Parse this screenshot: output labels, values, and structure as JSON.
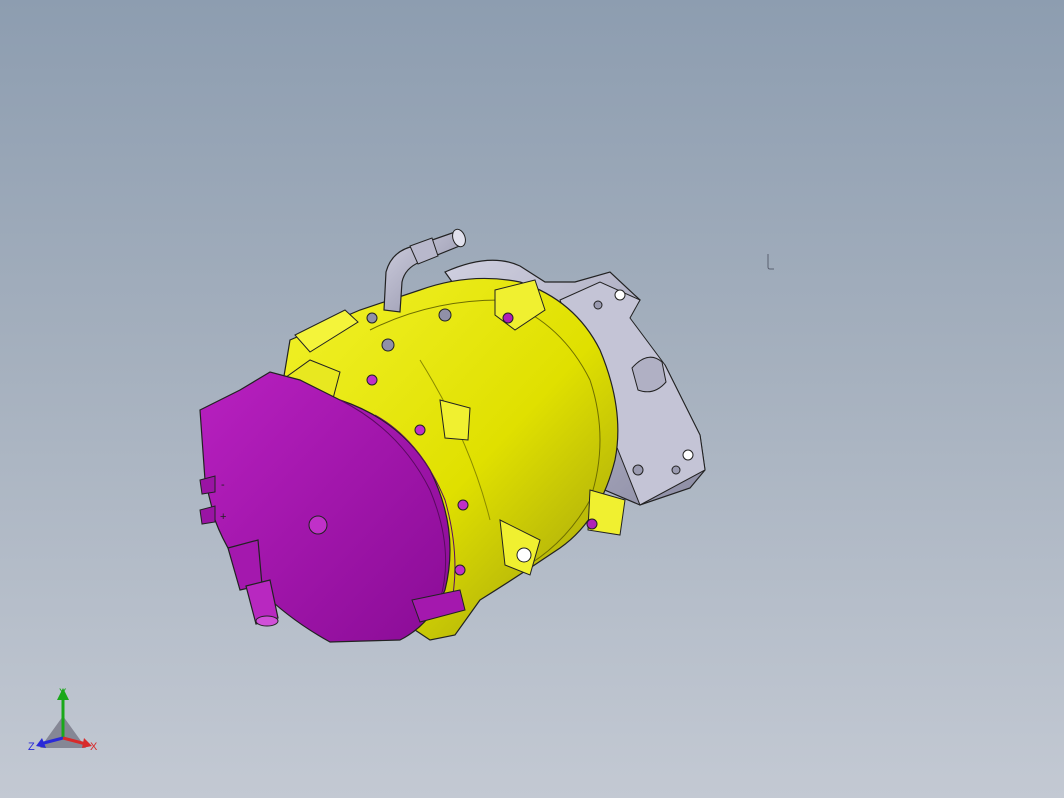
{
  "viewport": {
    "background_top": "#8d9db0",
    "background_bottom": "#c3c9d3"
  },
  "model": {
    "parts": [
      {
        "name": "motor-cover",
        "color": "#a010a8"
      },
      {
        "name": "compressor-housing",
        "color": "#e4e400"
      },
      {
        "name": "mounting-bracket",
        "color": "#b4b4c8"
      },
      {
        "name": "bolts",
        "color": "#8a8aa0"
      }
    ],
    "cover_markings": {
      "minus": "-",
      "plus": "+"
    }
  },
  "compass": {
    "y_label": "Y",
    "z_label": "Z",
    "x_label": "X",
    "y_color": "#1aa81a",
    "z_color": "#2a2ad8",
    "x_color": "#d82a2a"
  },
  "cursor_icon": "text-cursor-icon"
}
